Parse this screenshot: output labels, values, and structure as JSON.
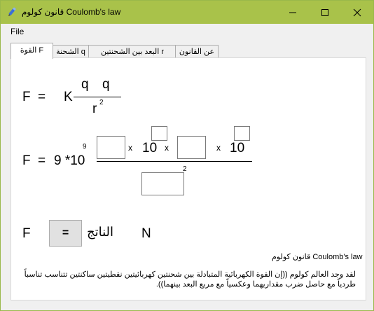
{
  "window": {
    "title": "قانون كولوم Coulomb's law",
    "icon": "pen-icon"
  },
  "menu": {
    "file": "File"
  },
  "tabs": [
    {
      "label": "القوة F",
      "active": true
    },
    {
      "label": "الشحنة q",
      "active": false
    },
    {
      "label": "البعد بين الشحنتين r",
      "active": false
    },
    {
      "label": "عن القانون",
      "active": false
    }
  ],
  "formula1": {
    "F": "F",
    "eq": "=",
    "K": "K",
    "q1": "q",
    "q2": "q",
    "r": "r",
    "exp": "2"
  },
  "formula2": {
    "F": "F",
    "eq": "=",
    "const": "9 *10",
    "const_exp": "9",
    "x1": "x",
    "ten1": "10",
    "x2": "x",
    "x3": "x",
    "ten2": "10",
    "r_exp": "2",
    "inputs": {
      "q1": "",
      "exp1": "",
      "q2": "",
      "exp2": "",
      "r": ""
    }
  },
  "result": {
    "F": "F",
    "button": "=",
    "label": "الناتج",
    "unit": "N"
  },
  "footer": {
    "heading": "قانون كولوم Coulomb's law",
    "description": "لقد وجد العالم كولوم ((إن القوة الكهربائية المتبادلة بين شحنتين كهربائيتين نقطيتين ساكنتين تتناسب تناسباً طردياً مع حاصل ضرب مقداريهما وعكسياً مع مربع البعد بينهما))."
  }
}
